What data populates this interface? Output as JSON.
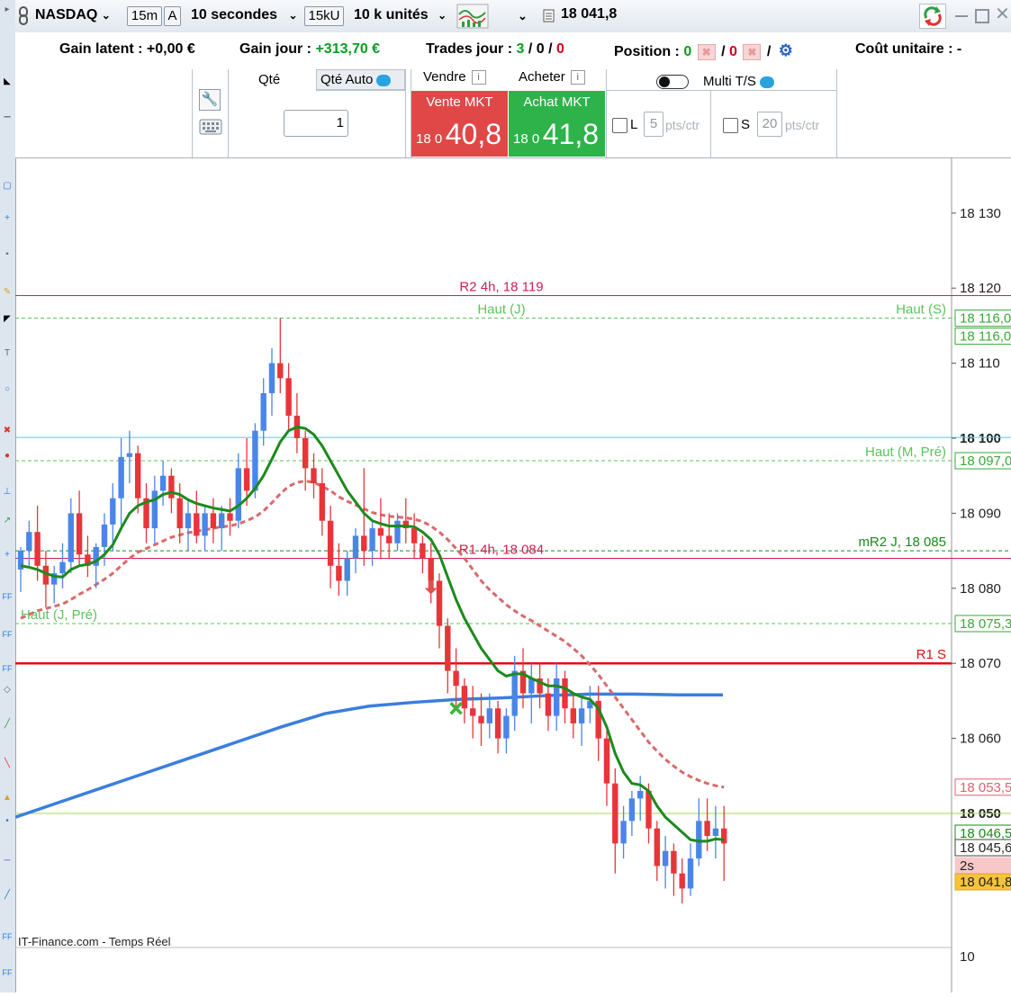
{
  "header": {
    "symbol": "NASDAQ",
    "timeframe": "15m",
    "mode_letter": "A",
    "tick_interval": "10 secondes",
    "unit_volume": "15kU",
    "quantity_units": "10 k unités",
    "last_price": "18 041,8"
  },
  "info": {
    "gain_latent_label": "Gain latent : ",
    "gain_latent_value": "+0,00 €",
    "gain_jour_label": "Gain jour : ",
    "gain_jour_value": "+313,70 €",
    "trades_label": "Trades jour : ",
    "trades_a": "3",
    "trades_sep1": " / ",
    "trades_b": "0",
    "trades_sep2": " / ",
    "trades_c": "0",
    "position_label": "Position : ",
    "position_a": "0",
    "position_sep": "/",
    "position_b": "0",
    "position_sep2": "/",
    "cout_label": "Coût unitaire : ",
    "cout_value": "-"
  },
  "order": {
    "qty_label": "Qté",
    "qty_auto_label": "Qté Auto",
    "qty_value": "1",
    "sell_header": "Vendre",
    "buy_header": "Acheter",
    "info_letter": "i",
    "sell_label": "Vente MKT",
    "buy_label": "Achat MKT",
    "sell_prefix": "18 0",
    "sell_price": "40,8",
    "buy_prefix": "18 0",
    "buy_price": "41,8",
    "multi_ts_label": "Multi T/S",
    "l_label": "L",
    "l_value": "5",
    "s_label": "S",
    "s_value": "20",
    "pts_label": "pts/ctr"
  },
  "chart_data": {
    "type": "candlestick",
    "title": "",
    "y_ticks": [
      {
        "value": 18130,
        "label": "18 130",
        "bold": false
      },
      {
        "value": 18120,
        "label": "18 120",
        "bold": false
      },
      {
        "value": 18110,
        "label": "18 110",
        "bold": false
      },
      {
        "value": 18100,
        "label": "18 100",
        "bold": true
      },
      {
        "value": 18090,
        "label": "18 090",
        "bold": false
      },
      {
        "value": 18080,
        "label": "18 080",
        "bold": false
      },
      {
        "value": 18070,
        "label": "18 070",
        "bold": false
      },
      {
        "value": 18060,
        "label": "18 060",
        "bold": false
      },
      {
        "value": 18050,
        "label": "18 050",
        "bold": true
      }
    ],
    "bottom_tick_label": "10",
    "watermark": "IT-Finance.com - Temps Réel",
    "levels": [
      {
        "value": 18119,
        "label": "R2 4h, 18 119",
        "label_pos": "center",
        "color": "#d02050",
        "style": "solid"
      },
      {
        "value": 18116,
        "label": "Haut (J)",
        "label_pos": "center",
        "color": "#5cc35c",
        "style": "dashed"
      },
      {
        "value": 18116,
        "label": "Haut (S)",
        "label_pos": "right",
        "color": "#5cc35c",
        "style": "none"
      },
      {
        "value": 18100.1,
        "label": "",
        "label_pos": "none",
        "color": "#4fd0d0",
        "style": "solid"
      },
      {
        "value": 18097,
        "label": "Haut (M, Pré)",
        "label_pos": "right",
        "color": "#5cc35c",
        "style": "dashed"
      },
      {
        "value": 18085,
        "label": "mR2 J, 18 085",
        "label_pos": "right",
        "color": "#1a8a1a",
        "style": "dashed"
      },
      {
        "value": 18084,
        "label": "R1 4h, 18 084",
        "label_pos": "center",
        "color": "#d02050",
        "style": "solid"
      },
      {
        "value": 18075.3,
        "label": "Haut (J, Pré)",
        "label_pos": "left",
        "color": "#5cc35c",
        "style": "dashed"
      },
      {
        "value": 18070,
        "label": "R1 S",
        "label_pos": "right",
        "color": "#e01010",
        "style": "thick"
      },
      {
        "value": 18050,
        "label": "",
        "label_pos": "none",
        "color": "#a5d94a",
        "style": "solid"
      }
    ],
    "price_tags": [
      {
        "value": 18116,
        "label": "18 116,0",
        "bg": "#ffffff",
        "fg": "#3aa93a",
        "border": "#3aa93a"
      },
      {
        "value": 18116,
        "label": "18 116,0",
        "bg": "#ffffff",
        "fg": "#3aa93a",
        "border": "#3aa93a"
      },
      {
        "value": 18097,
        "label": "18 097,0",
        "bg": "#ffffff",
        "fg": "#3aa93a",
        "border": "#3aa93a"
      },
      {
        "value": 18075.3,
        "label": "18 075,3",
        "bg": "#ffffff",
        "fg": "#3aa93a",
        "border": "#3aa93a"
      },
      {
        "value": 18053.5,
        "label": "18 053,5",
        "bg": "#ffffff",
        "fg": "#e06070",
        "border": "#e06070"
      },
      {
        "value": 18046.5,
        "label": "18 046,5",
        "bg": "#ffffff",
        "fg": "#1a8a1a",
        "border": "#1a8a1a"
      },
      {
        "value": 18045.6,
        "label": "18 045,6",
        "bg": "#ffffff",
        "fg": "#222222",
        "border": "#444444"
      },
      {
        "value": 18043,
        "label": "2s",
        "bg": "#f8c8c8",
        "fg": "#222222",
        "border": "#f8c8c8"
      },
      {
        "value": 18041.8,
        "label": "18 041,8",
        "bg": "#f6c33a",
        "fg": "#222222",
        "border": "#d9a420"
      }
    ],
    "candles": [
      {
        "o": 18082.5,
        "h": 18085.5,
        "l": 18079.5,
        "c": 18085
      },
      {
        "o": 18085,
        "h": 18089,
        "l": 18083,
        "c": 18087.5
      },
      {
        "o": 18087.5,
        "h": 18091,
        "l": 18081,
        "c": 18083
      },
      {
        "o": 18083,
        "h": 18085,
        "l": 18077.5,
        "c": 18080.5
      },
      {
        "o": 18080.5,
        "h": 18083,
        "l": 18078,
        "c": 18082
      },
      {
        "o": 18082,
        "h": 18086,
        "l": 18080,
        "c": 18083.5
      },
      {
        "o": 18083.5,
        "h": 18092,
        "l": 18082,
        "c": 18090
      },
      {
        "o": 18090,
        "h": 18093,
        "l": 18083,
        "c": 18084.5
      },
      {
        "o": 18084.5,
        "h": 18087,
        "l": 18081.5,
        "c": 18083
      },
      {
        "o": 18083,
        "h": 18086,
        "l": 18080,
        "c": 18085.5
      },
      {
        "o": 18085.5,
        "h": 18090,
        "l": 18083,
        "c": 18088.5
      },
      {
        "o": 18088.5,
        "h": 18094,
        "l": 18085,
        "c": 18092
      },
      {
        "o": 18092,
        "h": 18100,
        "l": 18088,
        "c": 18097.5
      },
      {
        "o": 18097.5,
        "h": 18101,
        "l": 18094,
        "c": 18098
      },
      {
        "o": 18098,
        "h": 18099,
        "l": 18090,
        "c": 18092
      },
      {
        "o": 18092,
        "h": 18094,
        "l": 18086,
        "c": 18088
      },
      {
        "o": 18088,
        "h": 18095,
        "l": 18086,
        "c": 18093
      },
      {
        "o": 18093,
        "h": 18097,
        "l": 18091,
        "c": 18095
      },
      {
        "o": 18095,
        "h": 18096,
        "l": 18090,
        "c": 18092
      },
      {
        "o": 18092,
        "h": 18094,
        "l": 18086,
        "c": 18088
      },
      {
        "o": 18088,
        "h": 18092,
        "l": 18085,
        "c": 18090
      },
      {
        "o": 18090,
        "h": 18093,
        "l": 18086,
        "c": 18087
      },
      {
        "o": 18087,
        "h": 18091,
        "l": 18085,
        "c": 18090
      },
      {
        "o": 18090,
        "h": 18092,
        "l": 18086,
        "c": 18088
      },
      {
        "o": 18088,
        "h": 18091,
        "l": 18085,
        "c": 18090
      },
      {
        "o": 18090,
        "h": 18092,
        "l": 18087,
        "c": 18089
      },
      {
        "o": 18089,
        "h": 18098,
        "l": 18088,
        "c": 18096
      },
      {
        "o": 18096,
        "h": 18100,
        "l": 18091,
        "c": 18093
      },
      {
        "o": 18093,
        "h": 18102,
        "l": 18092,
        "c": 18101
      },
      {
        "o": 18101,
        "h": 18108,
        "l": 18099,
        "c": 18106
      },
      {
        "o": 18106,
        "h": 18112,
        "l": 18103,
        "c": 18110
      },
      {
        "o": 18110,
        "h": 18116,
        "l": 18106,
        "c": 18108
      },
      {
        "o": 18108,
        "h": 18110,
        "l": 18101,
        "c": 18103
      },
      {
        "o": 18103,
        "h": 18106,
        "l": 18098,
        "c": 18100
      },
      {
        "o": 18100,
        "h": 18101,
        "l": 18093,
        "c": 18096
      },
      {
        "o": 18096,
        "h": 18098,
        "l": 18092,
        "c": 18094
      },
      {
        "o": 18094,
        "h": 18096,
        "l": 18087,
        "c": 18089
      },
      {
        "o": 18089,
        "h": 18091,
        "l": 18080,
        "c": 18083
      },
      {
        "o": 18083,
        "h": 18086,
        "l": 18079,
        "c": 18081
      },
      {
        "o": 18081,
        "h": 18085,
        "l": 18079,
        "c": 18084
      },
      {
        "o": 18084,
        "h": 18088,
        "l": 18082,
        "c": 18087
      },
      {
        "o": 18087,
        "h": 18096,
        "l": 18083,
        "c": 18085
      },
      {
        "o": 18085,
        "h": 18089,
        "l": 18083,
        "c": 18088
      },
      {
        "o": 18088,
        "h": 18092,
        "l": 18084,
        "c": 18087
      },
      {
        "o": 18087,
        "h": 18090,
        "l": 18084,
        "c": 18086
      },
      {
        "o": 18086,
        "h": 18090,
        "l": 18085,
        "c": 18089
      },
      {
        "o": 18089,
        "h": 18092,
        "l": 18086,
        "c": 18088
      },
      {
        "o": 18088,
        "h": 18090,
        "l": 18084,
        "c": 18086
      },
      {
        "o": 18086,
        "h": 18087,
        "l": 18082,
        "c": 18084
      },
      {
        "o": 18084,
        "h": 18086,
        "l": 18078,
        "c": 18081
      },
      {
        "o": 18081,
        "h": 18082,
        "l": 18072,
        "c": 18075
      },
      {
        "o": 18075,
        "h": 18076,
        "l": 18066,
        "c": 18069
      },
      {
        "o": 18069,
        "h": 18072,
        "l": 18064,
        "c": 18067
      },
      {
        "o": 18067,
        "h": 18068,
        "l": 18062,
        "c": 18064
      },
      {
        "o": 18064,
        "h": 18067,
        "l": 18060,
        "c": 18063
      },
      {
        "o": 18063,
        "h": 18066,
        "l": 18059,
        "c": 18062
      },
      {
        "o": 18062,
        "h": 18066,
        "l": 18060,
        "c": 18064
      },
      {
        "o": 18064,
        "h": 18065,
        "l": 18058,
        "c": 18060
      },
      {
        "o": 18060,
        "h": 18064,
        "l": 18058,
        "c": 18063
      },
      {
        "o": 18063,
        "h": 18071,
        "l": 18061,
        "c": 18069
      },
      {
        "o": 18069,
        "h": 18072,
        "l": 18064,
        "c": 18066
      },
      {
        "o": 18066,
        "h": 18070,
        "l": 18062,
        "c": 18068
      },
      {
        "o": 18068,
        "h": 18070,
        "l": 18064,
        "c": 18066
      },
      {
        "o": 18066,
        "h": 18068,
        "l": 18061,
        "c": 18063
      },
      {
        "o": 18063,
        "h": 18070,
        "l": 18061,
        "c": 18068
      },
      {
        "o": 18068,
        "h": 18069,
        "l": 18062,
        "c": 18064
      },
      {
        "o": 18064,
        "h": 18066,
        "l": 18060,
        "c": 18062
      },
      {
        "o": 18062,
        "h": 18066,
        "l": 18059,
        "c": 18064
      },
      {
        "o": 18064,
        "h": 18067,
        "l": 18062,
        "c": 18065
      },
      {
        "o": 18065,
        "h": 18067,
        "l": 18057,
        "c": 18060
      },
      {
        "o": 18060,
        "h": 18061,
        "l": 18051,
        "c": 18054
      },
      {
        "o": 18054,
        "h": 18056,
        "l": 18042,
        "c": 18046
      },
      {
        "o": 18046,
        "h": 18051,
        "l": 18044,
        "c": 18049
      },
      {
        "o": 18049,
        "h": 18053,
        "l": 18047,
        "c": 18052
      },
      {
        "o": 18052,
        "h": 18055,
        "l": 18049,
        "c": 18053
      },
      {
        "o": 18053,
        "h": 18054,
        "l": 18046,
        "c": 18048
      },
      {
        "o": 18048,
        "h": 18049,
        "l": 18041,
        "c": 18043
      },
      {
        "o": 18043,
        "h": 18047,
        "l": 18040,
        "c": 18045
      },
      {
        "o": 18045,
        "h": 18046,
        "l": 18039,
        "c": 18042
      },
      {
        "o": 18042,
        "h": 18044,
        "l": 18038,
        "c": 18040
      },
      {
        "o": 18040,
        "h": 18046,
        "l": 18039,
        "c": 18044
      },
      {
        "o": 18044,
        "h": 18052,
        "l": 18043,
        "c": 18049
      },
      {
        "o": 18049,
        "h": 18052,
        "l": 18045,
        "c": 18047
      },
      {
        "o": 18047,
        "h": 18051,
        "l": 18044,
        "c": 18048
      },
      {
        "o": 18048,
        "h": 18051,
        "l": 18041,
        "c": 18046
      }
    ],
    "ma_fast": [
      18083,
      18082.8,
      18082.5,
      18082,
      18081.6,
      18081.5,
      18082.5,
      18083,
      18083.2,
      18083.6,
      18084.5,
      18085.8,
      18088,
      18090,
      18091,
      18091.5,
      18091.8,
      18092.5,
      18092.8,
      18092.5,
      18091.8,
      18091.3,
      18091,
      18090.7,
      18090.5,
      18090.3,
      18091,
      18092,
      18093.3,
      18095,
      18097.2,
      18099.5,
      18101,
      18101.5,
      18101.3,
      18100.5,
      18099,
      18097,
      18095,
      18093,
      18091.5,
      18090,
      18089,
      18088.6,
      18088.3,
      18088.3,
      18088.3,
      18088.2,
      18087.5,
      18086.5,
      18084.5,
      18081.5,
      18078.5,
      18076,
      18074,
      18072,
      18070.5,
      18069,
      18068.3,
      18068.6,
      18068.6,
      18068,
      18067.5,
      18067,
      18067,
      18066.7,
      18066,
      18065.5,
      18065.2,
      18064,
      18061.5,
      18058,
      18055.5,
      18054,
      18053.8,
      18053,
      18051,
      18049.5,
      18048.5,
      18047.5,
      18046.5,
      18046.3,
      18046.3,
      18046.6,
      18046.5
    ],
    "ma_slow": [
      18076,
      18076.5,
      18077,
      18077.3,
      18077.6,
      18077.9,
      18078.5,
      18079.2,
      18079.8,
      18080.5,
      18081.2,
      18082,
      18083,
      18084,
      18084.8,
      18085.3,
      18085.8,
      18086.3,
      18086.8,
      18087.1,
      18087.4,
      18087.6,
      18087.8,
      18088,
      18088.2,
      18088.3,
      18088.6,
      18089,
      18089.5,
      18090.3,
      18091.4,
      18092.6,
      18093.6,
      18094.1,
      18094.3,
      18094.1,
      18093.6,
      18093,
      18092.2,
      18091.6,
      18091.1,
      18090.6,
      18090.1,
      18089.8,
      18089.6,
      18089.5,
      18089.4,
      18089.2,
      18088.9,
      18088.3,
      18087.5,
      18086.5,
      18085.3,
      18084,
      18082.5,
      18081,
      18079.8,
      18078.8,
      18077.8,
      18077,
      18076.3,
      18075.7,
      18075,
      18074.3,
      18073.6,
      18072.9,
      18072,
      18071,
      18069.8,
      18068.5,
      18067,
      18065.5,
      18064,
      18062.5,
      18061,
      18059.5,
      18058.3,
      18057.2,
      18056.3,
      18055.5,
      18054.9,
      18054.4,
      18054,
      18053.7,
      18053.5
    ],
    "vwap": {
      "start_value": 18049.5,
      "points": [
        18049.5,
        18051.5,
        18053.5,
        18055.5,
        18057.5,
        18059.5,
        18061.5,
        18063.3,
        18064.3,
        18064.8,
        18065.2,
        18065.4,
        18065.7,
        18065.9,
        18065.9,
        18065.8,
        18065.8
      ]
    },
    "markers": [
      {
        "type": "cross",
        "candle_index": 52,
        "value": 18064,
        "color": "#3cb43c"
      },
      {
        "type": "down-arrow",
        "candle_index": 49,
        "value": 18081,
        "color": "#e05050"
      }
    ]
  },
  "colors": {
    "up_candle": "#4a86e8",
    "down_candle": "#e8353a",
    "ma_fast": "#1c8a1c",
    "ma_slow": "#d86a6a",
    "vwap": "#3a7ee0",
    "sell_button": "#e04848",
    "buy_button": "#2db34a"
  },
  "icons": {
    "symbol_link": "link-icon",
    "chart_type": "candles-icon",
    "tools": "wrench-icon",
    "keyboard": "keyboard-icon",
    "refresh": "refresh-arrows-icon",
    "settings": "gears-icon"
  }
}
